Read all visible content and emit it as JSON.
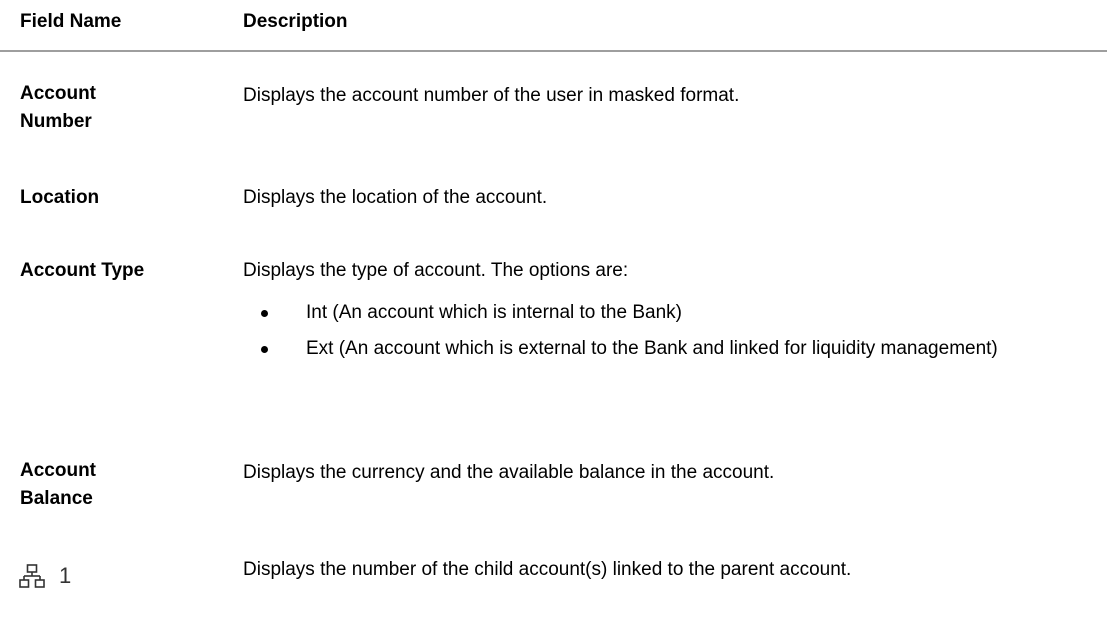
{
  "header": {
    "field_name": "Field Name",
    "description": "Description"
  },
  "rows": [
    {
      "field": "Account Number",
      "description": "Displays the account number of the user in masked format."
    },
    {
      "field": "Location",
      "description": "Displays the location of the account."
    },
    {
      "field": "Account Type",
      "description": "Displays the type of account. The options are:",
      "options": [
        "Int (An account which is internal to the Bank)",
        "Ext (An account which is external to the Bank and linked for liquidity management)"
      ]
    },
    {
      "field": "Account Balance",
      "description": "Displays the currency and the available balance in the account."
    },
    {
      "field_icon": "hierarchy-icon",
      "field_count": "1",
      "description": "Displays the number of the child account(s) linked to the parent account."
    }
  ],
  "colors": {
    "header_rule": "#9e9e9e",
    "text": "#000000",
    "icon": "#333333"
  }
}
